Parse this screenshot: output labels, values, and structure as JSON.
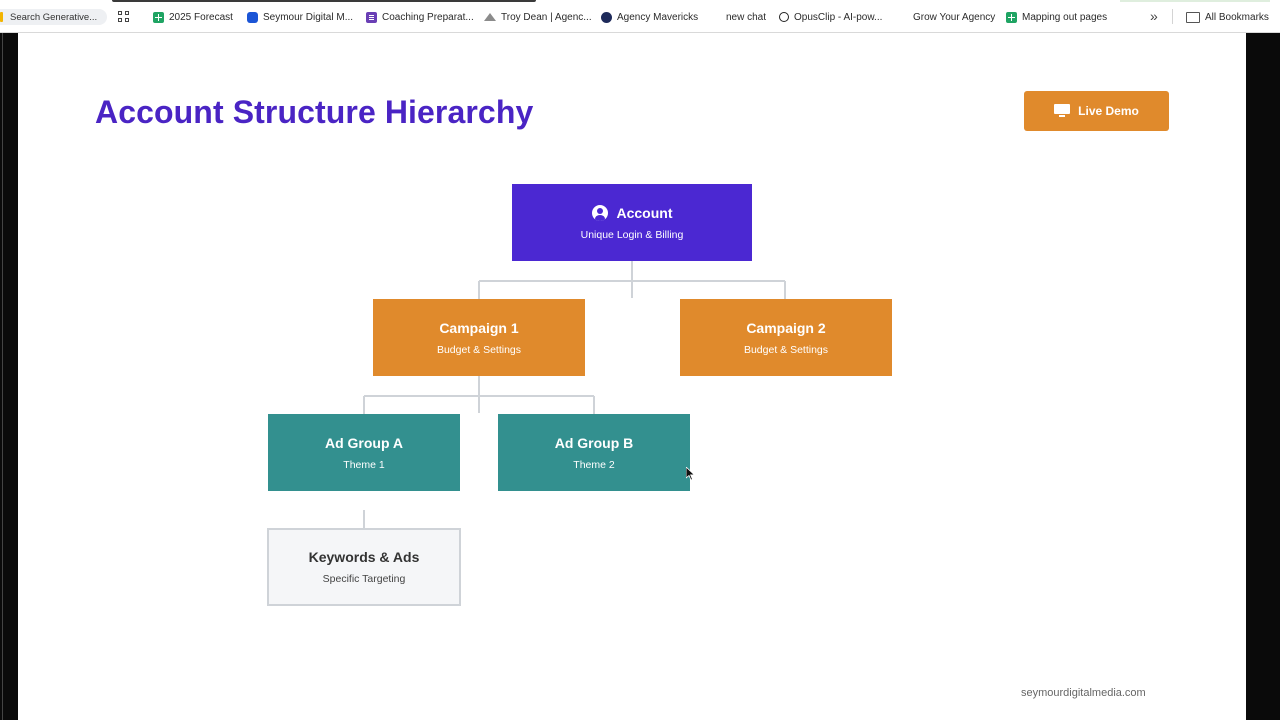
{
  "bookmarks_bar": {
    "search_label": "Search Generative...",
    "items": [
      {
        "label": "2025 Forecast",
        "icon": "sheets-icon"
      },
      {
        "label": "Seymour Digital M...",
        "icon": "blue-app-icon"
      },
      {
        "label": "Coaching Preparat...",
        "icon": "forms-icon"
      },
      {
        "label": "Troy Dean | Agenc...",
        "icon": "mountain-icon"
      },
      {
        "label": "Agency Mavericks",
        "icon": "mavericks-icon"
      },
      {
        "label": "new chat",
        "icon": ""
      },
      {
        "label": "OpusClip - AI-pow...",
        "icon": "opus-icon"
      },
      {
        "label": "Grow Your Agency",
        "icon": ""
      },
      {
        "label": "Mapping out pages",
        "icon": "sheets-icon"
      }
    ],
    "overflow_label": "»",
    "all_bookmarks_label": "All Bookmarks"
  },
  "slide": {
    "title": "Account Structure Hierarchy",
    "live_demo_label": "Live Demo",
    "footer_url": "seymourdigitalmedia.com"
  },
  "hierarchy": {
    "account": {
      "title": "Account",
      "subtitle": "Unique Login & Billing",
      "color": "#4b28d2"
    },
    "campaign1": {
      "title": "Campaign 1",
      "subtitle": "Budget & Settings",
      "color": "#e08a2c"
    },
    "campaign2": {
      "title": "Campaign 2",
      "subtitle": "Budget & Settings",
      "color": "#e08a2c"
    },
    "adgroupA": {
      "title": "Ad Group A",
      "subtitle": "Theme 1",
      "color": "#33908f"
    },
    "adgroupB": {
      "title": "Ad Group B",
      "subtitle": "Theme 2",
      "color": "#33908f"
    },
    "keywords": {
      "title": "Keywords & Ads",
      "subtitle": "Specific Targeting",
      "color": "#f5f6f8"
    }
  },
  "colors": {
    "title": "#4a24c4",
    "accent_orange": "#e08a2c",
    "connector": "#cfd3d8"
  }
}
